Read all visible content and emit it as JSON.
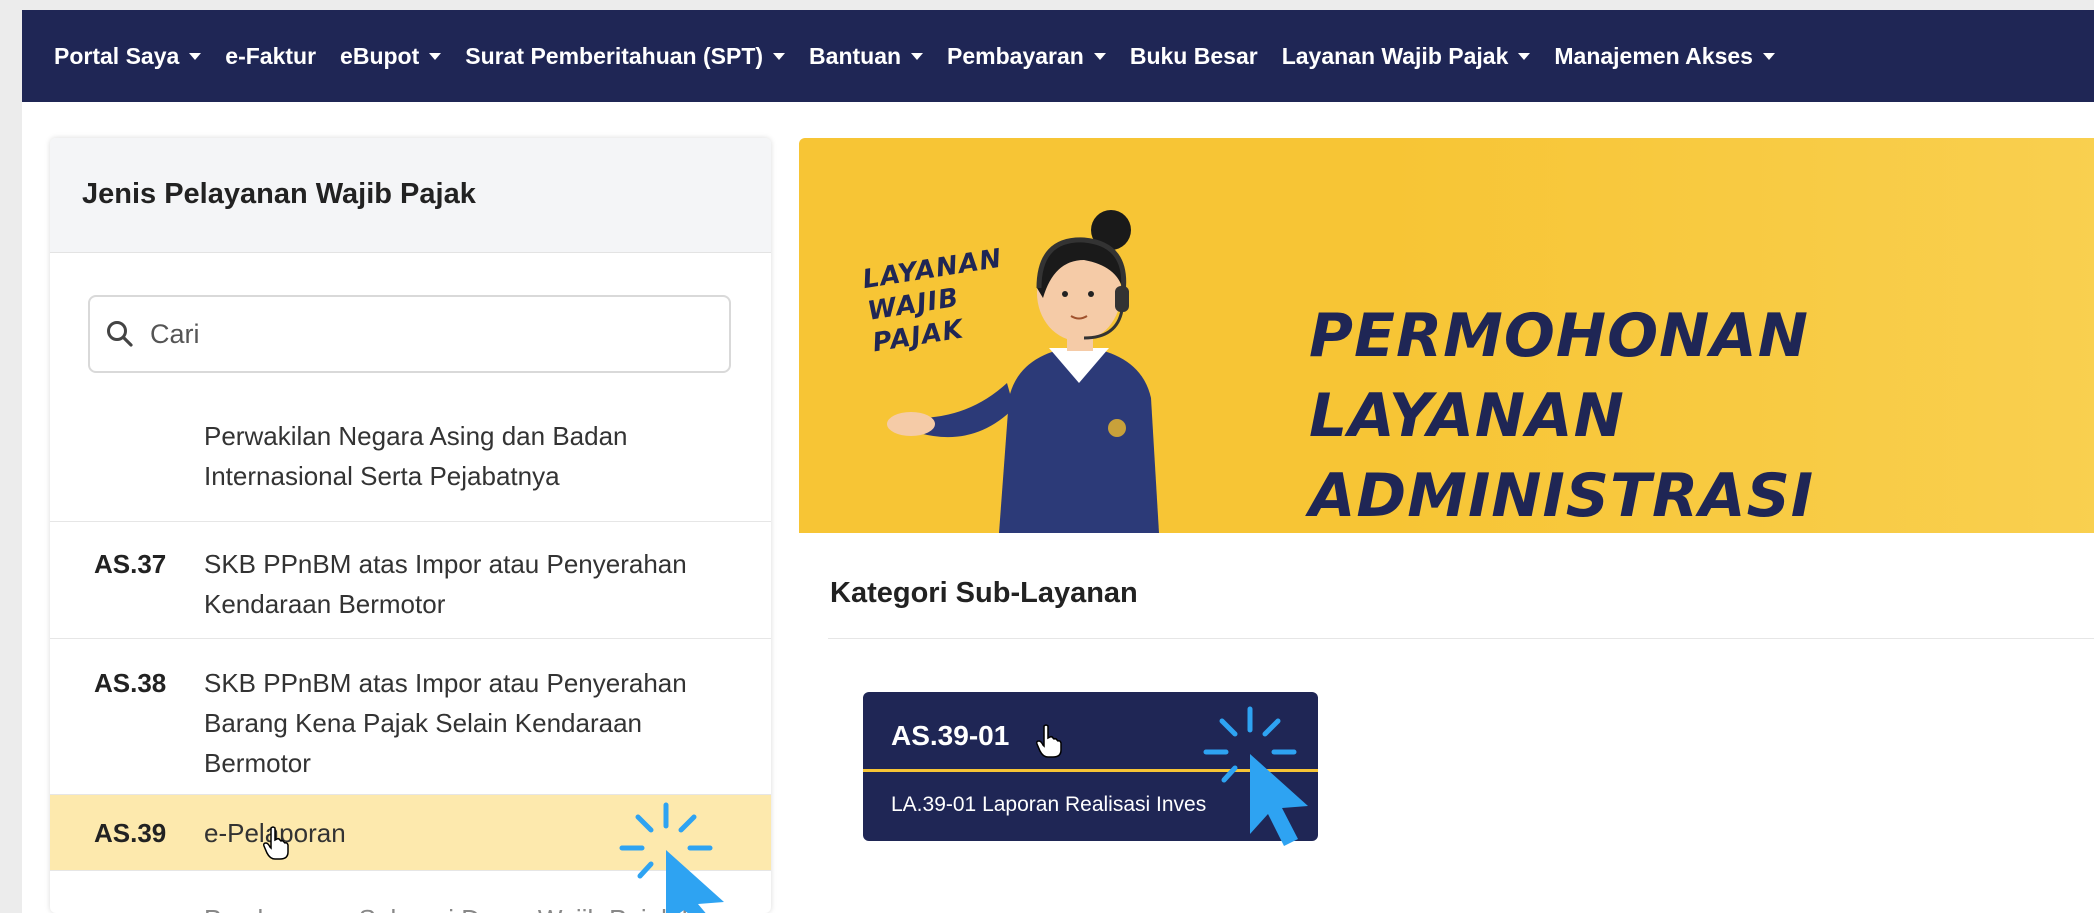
{
  "nav": {
    "items": [
      {
        "label": "Portal Saya",
        "dropdown": true
      },
      {
        "label": "e-Faktur",
        "dropdown": false
      },
      {
        "label": "eBupot",
        "dropdown": true
      },
      {
        "label": "Surat Pemberitahuan (SPT)",
        "dropdown": true
      },
      {
        "label": "Bantuan",
        "dropdown": true
      },
      {
        "label": "Pembayaran",
        "dropdown": true
      },
      {
        "label": "Buku Besar",
        "dropdown": false
      },
      {
        "label": "Layanan Wajib Pajak",
        "dropdown": true
      },
      {
        "label": "Manajemen Akses",
        "dropdown": true
      }
    ]
  },
  "sidebar": {
    "title": "Jenis Pelayanan Wajib Pajak",
    "search": {
      "placeholder": "Cari",
      "icon": "search-icon"
    },
    "items": [
      {
        "code": "",
        "label_lines": [
          "Perwakilan Negara Asing dan Badan",
          "Internasional Serta Pejabatnya"
        ]
      },
      {
        "code": "AS.37",
        "label_lines": [
          "SKB PPnBM atas Impor atau Penyerahan",
          "Kendaraan Bermotor"
        ]
      },
      {
        "code": "AS.38",
        "label_lines": [
          "SKB PPnBM atas Impor atau Penyerahan",
          "Barang Kena Pajak Selain Kendaraan",
          "Bermotor"
        ]
      },
      {
        "code": "AS.39",
        "label_lines": [
          "e-Pelaporan"
        ],
        "selected": true
      },
      {
        "code": "",
        "label_lines": [
          "Pembayaran Sebagai Dasar Wajib Pajak Baru"
        ]
      }
    ]
  },
  "banner": {
    "badge": [
      "LAYANAN",
      "WAJIB",
      "PAJAK"
    ],
    "title": [
      "PERMOHONAN LAYANAN",
      "ADMINISTRASI"
    ]
  },
  "main": {
    "section_title": "Kategori Sub-Layanan",
    "cards": [
      {
        "code": "AS.39-01",
        "title": "LA.39-01 Laporan Realisasi Inves"
      }
    ]
  },
  "colors": {
    "nav_bg": "#1f2655",
    "banner_bg": "#f7c535",
    "selected_row": "#fde9ad",
    "card_bg": "#1f2655",
    "pointer": "#2ea3f2"
  }
}
